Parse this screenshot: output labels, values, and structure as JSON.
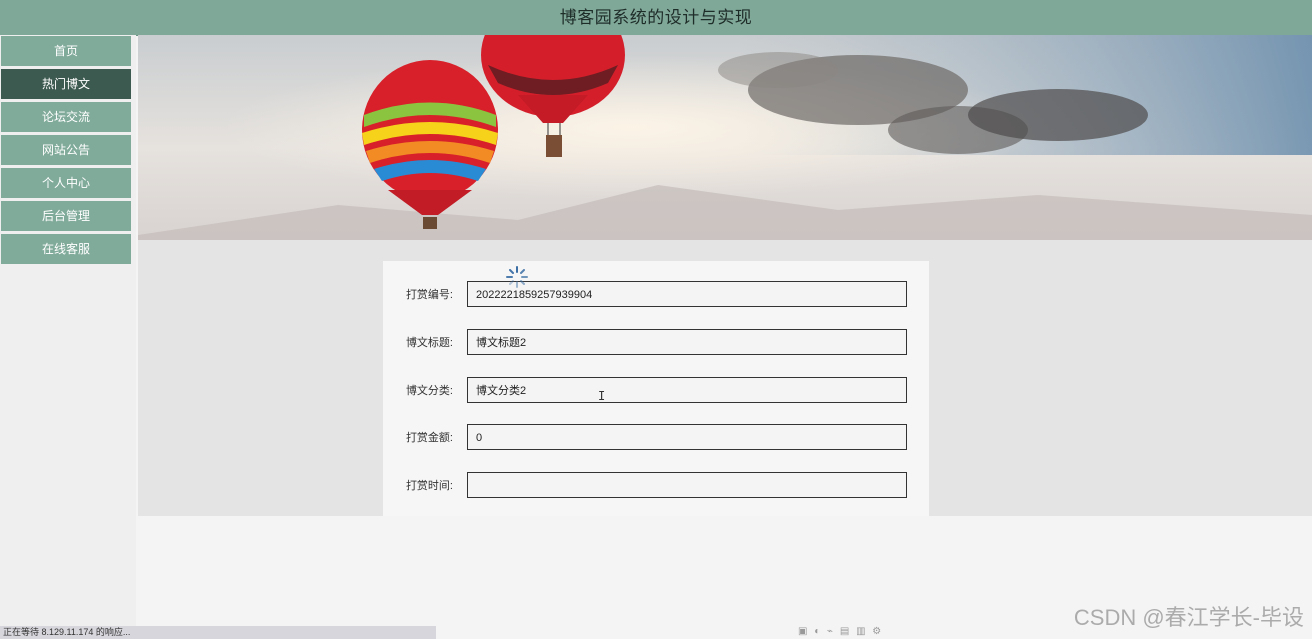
{
  "header": {
    "title": "博客园系统的设计与实现"
  },
  "sidebar": {
    "items": [
      {
        "label": "首页"
      },
      {
        "label": "热门博文"
      },
      {
        "label": "论坛交流"
      },
      {
        "label": "网站公告"
      },
      {
        "label": "个人中心"
      },
      {
        "label": "后台管理"
      },
      {
        "label": "在线客服"
      }
    ],
    "active_index": 1
  },
  "form": {
    "fields": [
      {
        "label": "打赏编号:",
        "value": "2022221859257939904"
      },
      {
        "label": "博文标题:",
        "value": "博文标题2"
      },
      {
        "label": "博文分类:",
        "value": "博文分类2"
      },
      {
        "label": "打赏金额:",
        "value": "0"
      },
      {
        "label": "打赏时间:",
        "value": ""
      }
    ]
  },
  "statusbar": {
    "text": "正在等待 8.129.11.174 的响应..."
  },
  "watermark": {
    "text": "CSDN @春江学长-毕设"
  },
  "colors": {
    "header_bg": "#7fa899",
    "nav_bg": "#80ab9b",
    "nav_active_bg": "#3d5a50"
  }
}
